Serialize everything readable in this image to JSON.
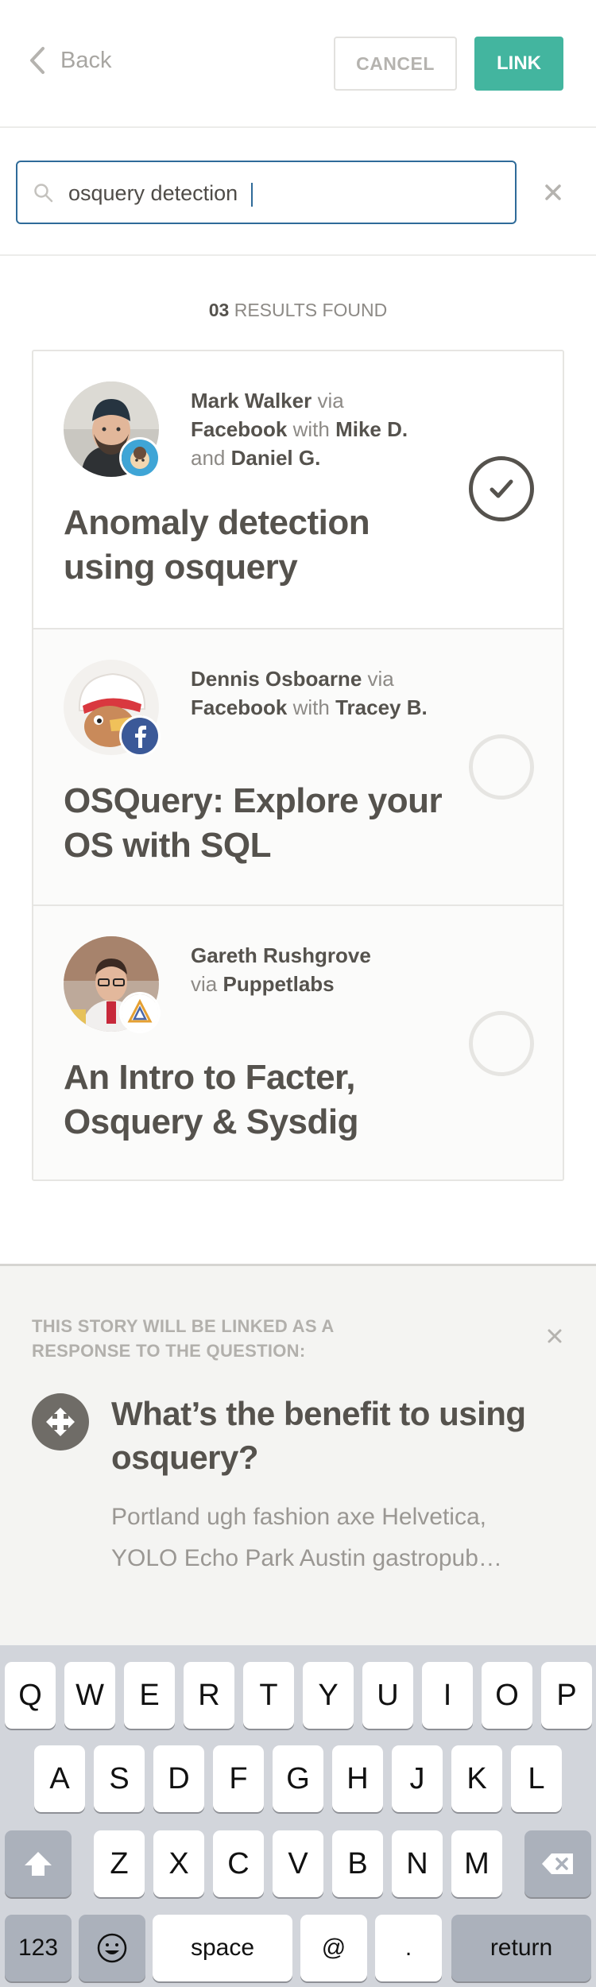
{
  "header": {
    "back_label": "Back",
    "cancel_label": "CANCEL",
    "link_label": "LINK"
  },
  "search": {
    "value": "osquery detection",
    "icon": "search-icon",
    "clear_icon": "close-icon"
  },
  "results": {
    "count": "03",
    "count_suffix": "RESULTS FOUND",
    "items": [
      {
        "author": "Mark Walker",
        "via_word": "via",
        "source": "Facebook",
        "with_word": "with",
        "with_name_1": "Mike D.",
        "and_word": "and",
        "with_name_2": "Daniel G.",
        "title": "Anomaly detection using osquery",
        "badge": "mailchimp-badge-icon",
        "selected": true
      },
      {
        "author": "Dennis Osboarne",
        "via_word": "via",
        "source": "Facebook",
        "with_word": "with",
        "with_name_1": "Tracey B.",
        "title": "OSQuery: Explore your OS with SQL",
        "badge": "facebook-badge-icon",
        "selected": false
      },
      {
        "author": "Gareth Rushgrove",
        "via_word": "via",
        "source": "Puppetlabs",
        "title": "An Intro to Facter, Osquery & Sysdig",
        "badge": "puppetlabs-badge-icon",
        "selected": false
      }
    ]
  },
  "linked_question": {
    "label": "THIS STORY WILL BE LINKED AS A RESPONSE TO THE QUESTION:",
    "title": "What’s the benefit to using osquery?",
    "body": "Portland ugh fashion axe Helvetica, YOLO Echo Park Austin gastropub…",
    "icon": "question-icon"
  },
  "keyboard": {
    "row1": [
      "Q",
      "W",
      "E",
      "R",
      "T",
      "Y",
      "U",
      "I",
      "O",
      "P"
    ],
    "row2": [
      "A",
      "S",
      "D",
      "F",
      "G",
      "H",
      "J",
      "K",
      "L"
    ],
    "row3": [
      "Z",
      "X",
      "C",
      "V",
      "B",
      "N",
      "M"
    ],
    "numbers_label": "123",
    "space_label": "space",
    "at_label": "@",
    "dot_label": ".",
    "return_label": "return",
    "shift_icon": "shift-icon",
    "delete_icon": "delete-icon",
    "emoji_icon": "emoji-icon"
  },
  "colors": {
    "accent": "#43b59f",
    "text": "#55524d",
    "focus_border": "#2f6b99"
  }
}
